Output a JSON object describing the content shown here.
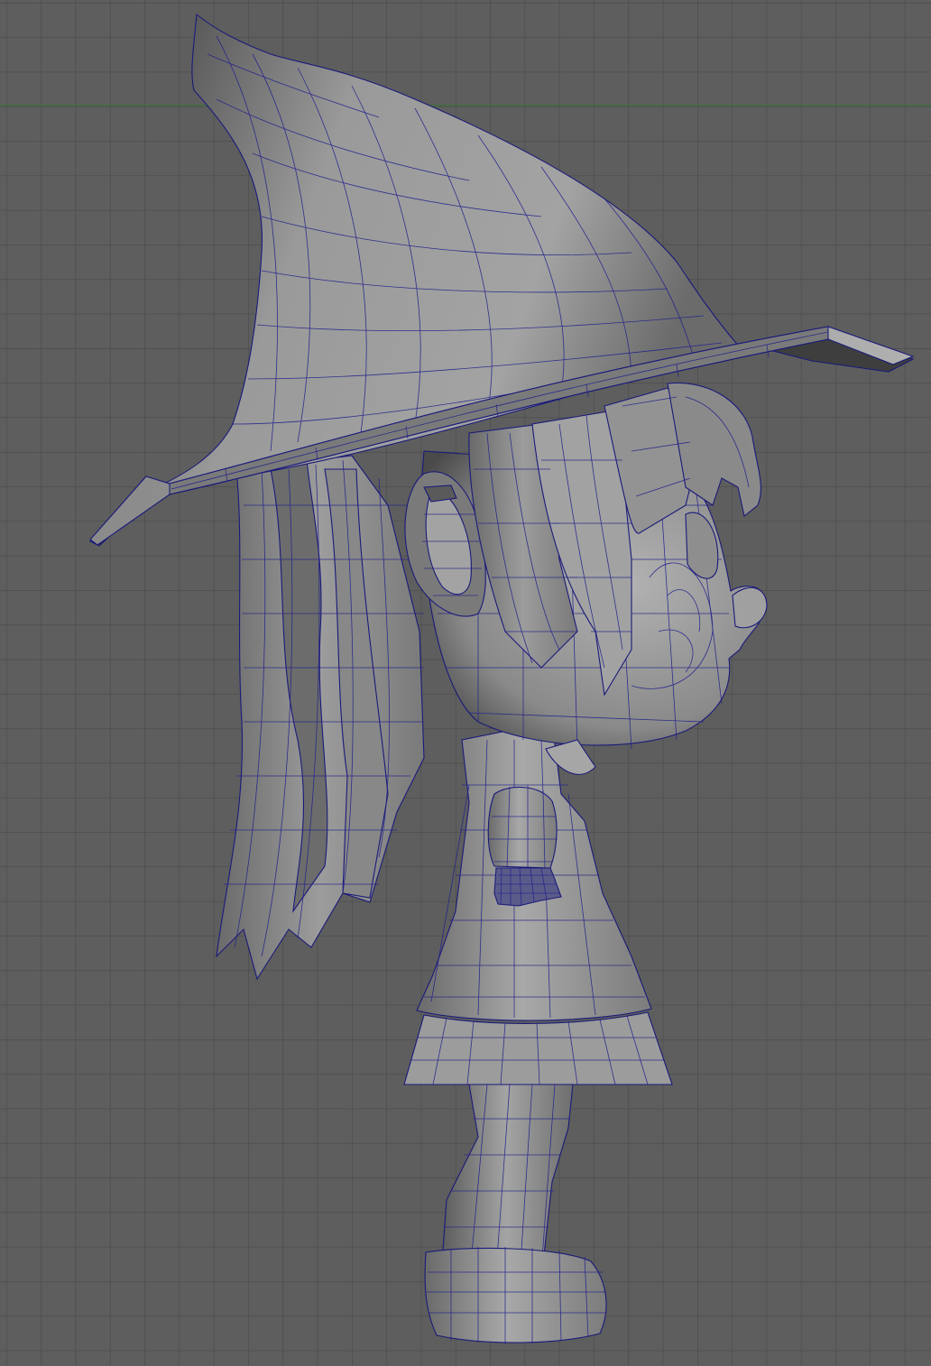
{
  "viewport": {
    "view": "side",
    "background_color": "#5e5e5e",
    "grid_color": "#494949",
    "axis_line_color": "#3f6f3f",
    "wireframe_color": "#23238c",
    "shading": "smooth-shade-with-wireframe"
  },
  "model": {
    "parts": [
      {
        "name": "hat-cone",
        "icon": "hat-icon"
      },
      {
        "name": "hat-brim",
        "icon": "hat-icon"
      },
      {
        "name": "hair-back",
        "icon": "hair-icon"
      },
      {
        "name": "hair-bangs",
        "icon": "hair-icon"
      },
      {
        "name": "head",
        "icon": "head-icon"
      },
      {
        "name": "ear",
        "icon": "ear-icon"
      },
      {
        "name": "neck",
        "icon": "neck-icon"
      },
      {
        "name": "arm",
        "icon": "arm-icon"
      },
      {
        "name": "hand",
        "icon": "hand-icon"
      },
      {
        "name": "dress",
        "icon": "dress-icon"
      },
      {
        "name": "skirt",
        "icon": "skirt-icon"
      },
      {
        "name": "leg",
        "icon": "leg-icon"
      },
      {
        "name": "shoe",
        "icon": "shoe-icon"
      }
    ]
  }
}
